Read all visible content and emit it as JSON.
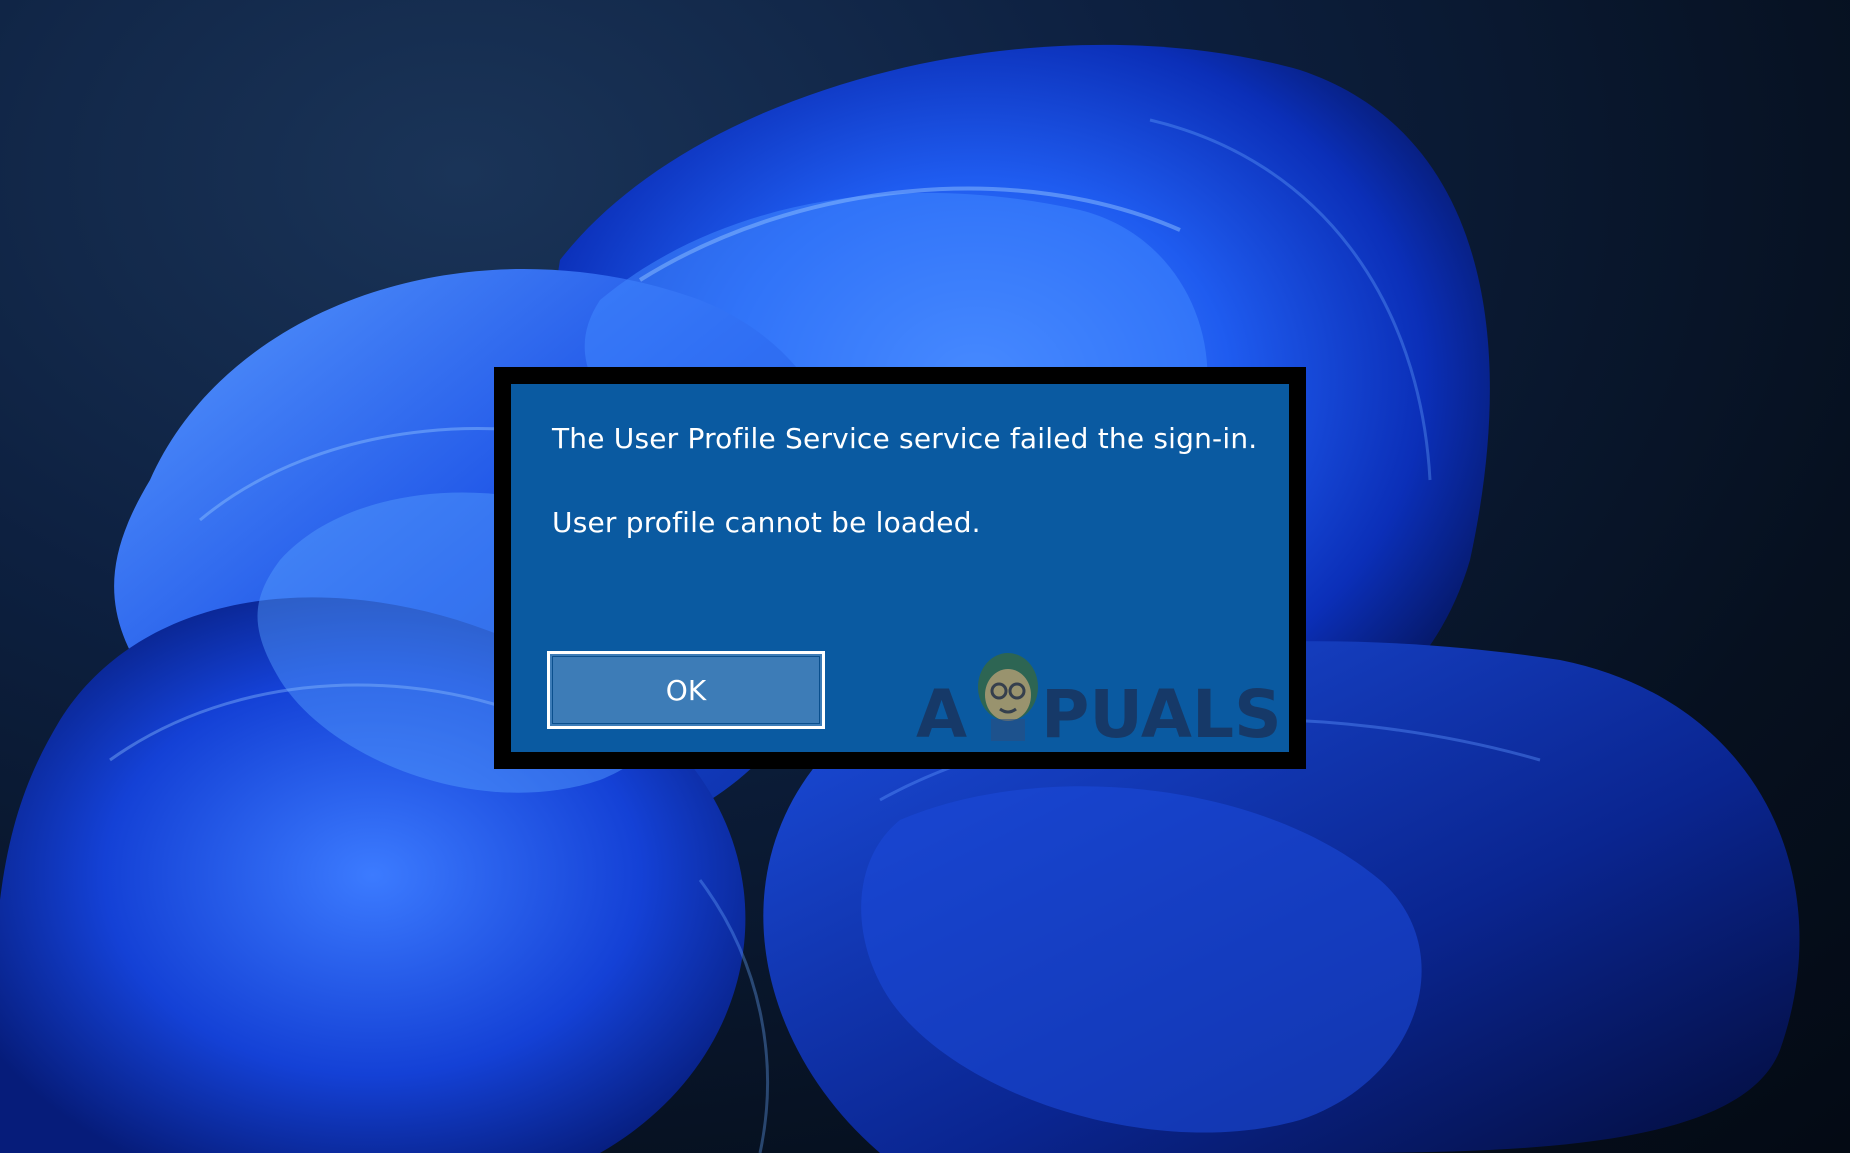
{
  "dialog": {
    "line1": "The User Profile Service service failed the sign-in.",
    "line2": "User profile cannot be loaded.",
    "ok_label": "OK"
  },
  "watermark": {
    "text": "APPUALS"
  },
  "colors": {
    "dialog_background": "#0a5aa1",
    "ok_button_background": "#3d7cb7",
    "frame": "#000000",
    "text": "#ffffff"
  }
}
